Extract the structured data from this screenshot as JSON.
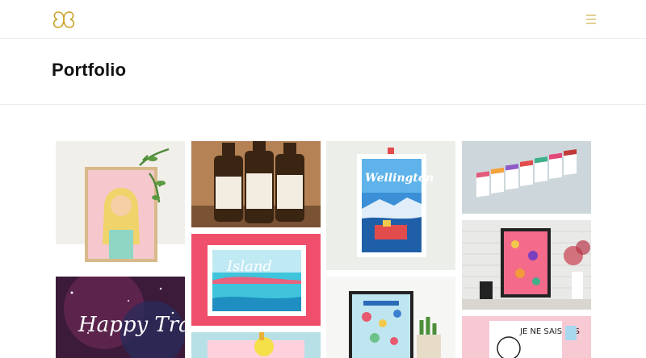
{
  "header": {
    "logo_icon": "monogram-logo-icon",
    "menu_icon": "hamburger-menu-icon",
    "accent": "#c9a227"
  },
  "page": {
    "title": "Portfolio"
  },
  "gallery": {
    "items": [
      {
        "subject": "framed-portrait-illustration",
        "text": ""
      },
      {
        "subject": "beer-bottles-photo",
        "text": ""
      },
      {
        "subject": "wellington-poster",
        "text": "Wellington"
      },
      {
        "subject": "greeting-cards-set",
        "text": ""
      },
      {
        "subject": "island-stamp-illustration",
        "text": "Island"
      },
      {
        "subject": "framed-pink-poster",
        "text": ""
      },
      {
        "subject": "happy-travels-poster",
        "text": "Happy Travels"
      },
      {
        "subject": "yellow-pink-illustration",
        "text": ""
      },
      {
        "subject": "framed-blue-poster",
        "text": ""
      },
      {
        "subject": "je-ne-sais-pas-poster",
        "text": "JE NE SAIS PAS"
      }
    ]
  }
}
